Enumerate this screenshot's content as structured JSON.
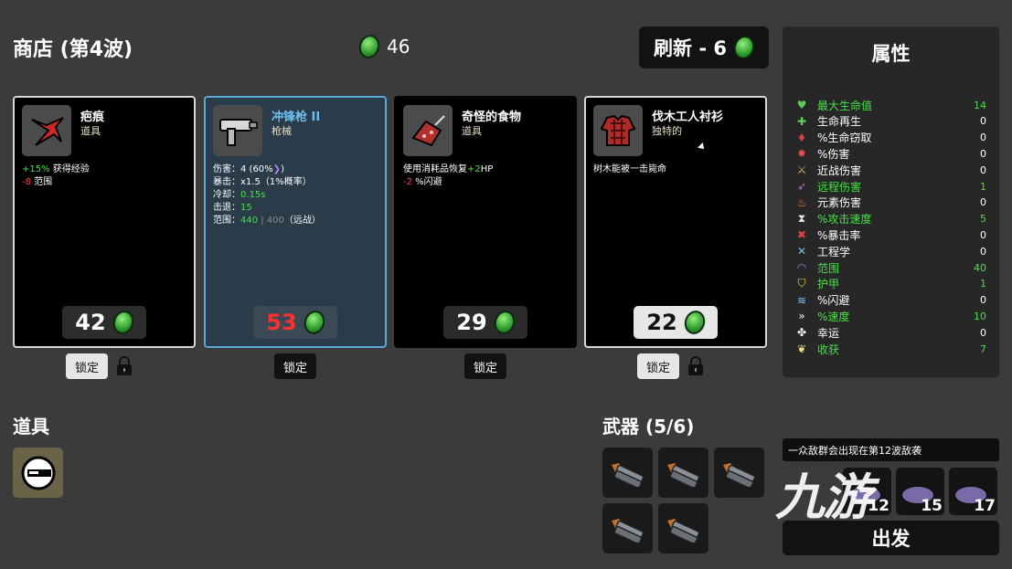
{
  "header": {
    "title": "商店 (第4波)",
    "coins": "46",
    "refresh_label": "刷新 - 6"
  },
  "colors": {
    "accent_green": "#47e047",
    "negative_red": "#ff4040",
    "selected_border": "#5aa8d8"
  },
  "cards": [
    {
      "name": "疤痕",
      "type": "道具",
      "icon": "scar-icon",
      "lines": [
        {
          "value": "+15%",
          "value_color": "green",
          "text": " 获得经验"
        },
        {
          "value": "-8",
          "value_color": "red",
          "text": " 范围"
        }
      ],
      "price": "42",
      "lock_label": "锁定"
    },
    {
      "name": "冲锋枪 II",
      "type": "枪械",
      "icon": "smg-icon",
      "lines": [
        {
          "prefix": "伤害：",
          "value": "4 (60%",
          "tail": ")"
        },
        {
          "prefix": "暴击：",
          "value": "x1.5",
          "tail": "（1%概率）"
        },
        {
          "prefix": "冷却：",
          "value": "0.15s",
          "value_color": "green"
        },
        {
          "prefix": "击退：",
          "value": "15",
          "value_color": "green"
        },
        {
          "prefix": "范围：",
          "value": "440",
          "value_color": "green",
          "extra": " | 400",
          "tail": "（远战）"
        }
      ],
      "price": "53",
      "lock_label": "锁定"
    },
    {
      "name": "奇怪的食物",
      "type": "道具",
      "icon": "strange-food-icon",
      "lines": [
        {
          "text_pre": "使用消耗品恢复",
          "value": "+2",
          "value_color": "green",
          "text": "HP"
        },
        {
          "value": "-2",
          "value_color": "red",
          "text": " %闪避"
        }
      ],
      "price": "29",
      "lock_label": "锁定"
    },
    {
      "name": "伐木工人衬衫",
      "type": "独特的",
      "icon": "lumberjack-shirt-icon",
      "lines": [
        {
          "text": "树木能被一击毙命"
        }
      ],
      "price": "22",
      "lock_label": "锁定"
    }
  ],
  "stats": {
    "title": "属性",
    "items": [
      {
        "label": "最大生命值",
        "value": "14",
        "highlight": true,
        "icon": "heart-icon"
      },
      {
        "label": "生命再生",
        "value": "0",
        "highlight": false,
        "icon": "regen-icon"
      },
      {
        "label": "%生命窃取",
        "value": "0",
        "highlight": false,
        "icon": "lifesteal-icon"
      },
      {
        "label": "%伤害",
        "value": "0",
        "highlight": false,
        "icon": "damage-icon"
      },
      {
        "label": "近战伤害",
        "value": "0",
        "highlight": false,
        "icon": "melee-icon"
      },
      {
        "label": "远程伤害",
        "value": "1",
        "highlight": true,
        "icon": "ranged-icon"
      },
      {
        "label": "元素伤害",
        "value": "0",
        "highlight": false,
        "icon": "elemental-icon"
      },
      {
        "label": "%攻击速度",
        "value": "5",
        "highlight": true,
        "icon": "attack-speed-icon"
      },
      {
        "label": "%暴击率",
        "value": "0",
        "highlight": false,
        "icon": "crit-icon"
      },
      {
        "label": "工程学",
        "value": "0",
        "highlight": false,
        "icon": "engineering-icon"
      },
      {
        "label": "范围",
        "value": "40",
        "highlight": true,
        "icon": "range-icon"
      },
      {
        "label": "护甲",
        "value": "1",
        "highlight": true,
        "icon": "armor-icon"
      },
      {
        "label": "%闪避",
        "value": "0",
        "highlight": false,
        "icon": "dodge-icon"
      },
      {
        "label": "%速度",
        "value": "10",
        "highlight": true,
        "icon": "speed-icon"
      },
      {
        "label": "幸运",
        "value": "0",
        "highlight": false,
        "icon": "luck-icon"
      },
      {
        "label": "收获",
        "value": "7",
        "highlight": true,
        "icon": "harvest-icon"
      }
    ]
  },
  "items": {
    "title": "道具"
  },
  "weapons": {
    "title": "武器 (5/6)"
  },
  "wave_notice": "一众敌群会出现在第12波敌袭",
  "enemies": [
    "12",
    "15",
    "17"
  ],
  "go_label": "出发",
  "watermark": "九游"
}
